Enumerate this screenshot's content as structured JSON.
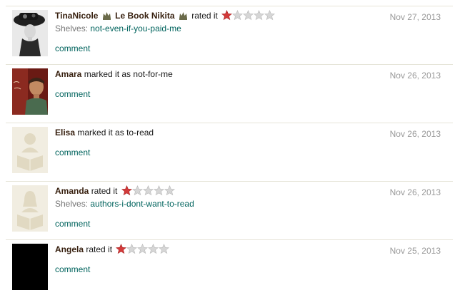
{
  "reviews": [
    {
      "user": "TinaNicole",
      "secondary_user": "Le Book Nikita",
      "action": "rated it",
      "rating": 1,
      "shelves_label": "Shelves:",
      "shelf": "not-even-if-you-paid-me",
      "comment": "comment",
      "date": "Nov 27, 2013"
    },
    {
      "user": "Amara",
      "action": "marked it as not-for-me",
      "comment": "comment",
      "date": "Nov 26, 2013"
    },
    {
      "user": "Elisa",
      "action": "marked it as to-read",
      "comment": "comment",
      "date": "Nov 26, 2013"
    },
    {
      "user": "Amanda",
      "action": "rated it",
      "rating": 1,
      "shelves_label": "Shelves:",
      "shelf": "authors-i-dont-want-to-read",
      "comment": "comment",
      "date": "Nov 26, 2013"
    },
    {
      "user": "Angela",
      "action": "rated it",
      "rating": 1,
      "comment": "comment",
      "date": "Nov 25, 2013"
    }
  ],
  "rating_scale": 5,
  "colors": {
    "username": "#382110",
    "link": "#00635d",
    "star_filled": "#d33a3a",
    "star_empty": "#d6d6d6",
    "date": "#999999",
    "separator": "#e6e4d8"
  }
}
